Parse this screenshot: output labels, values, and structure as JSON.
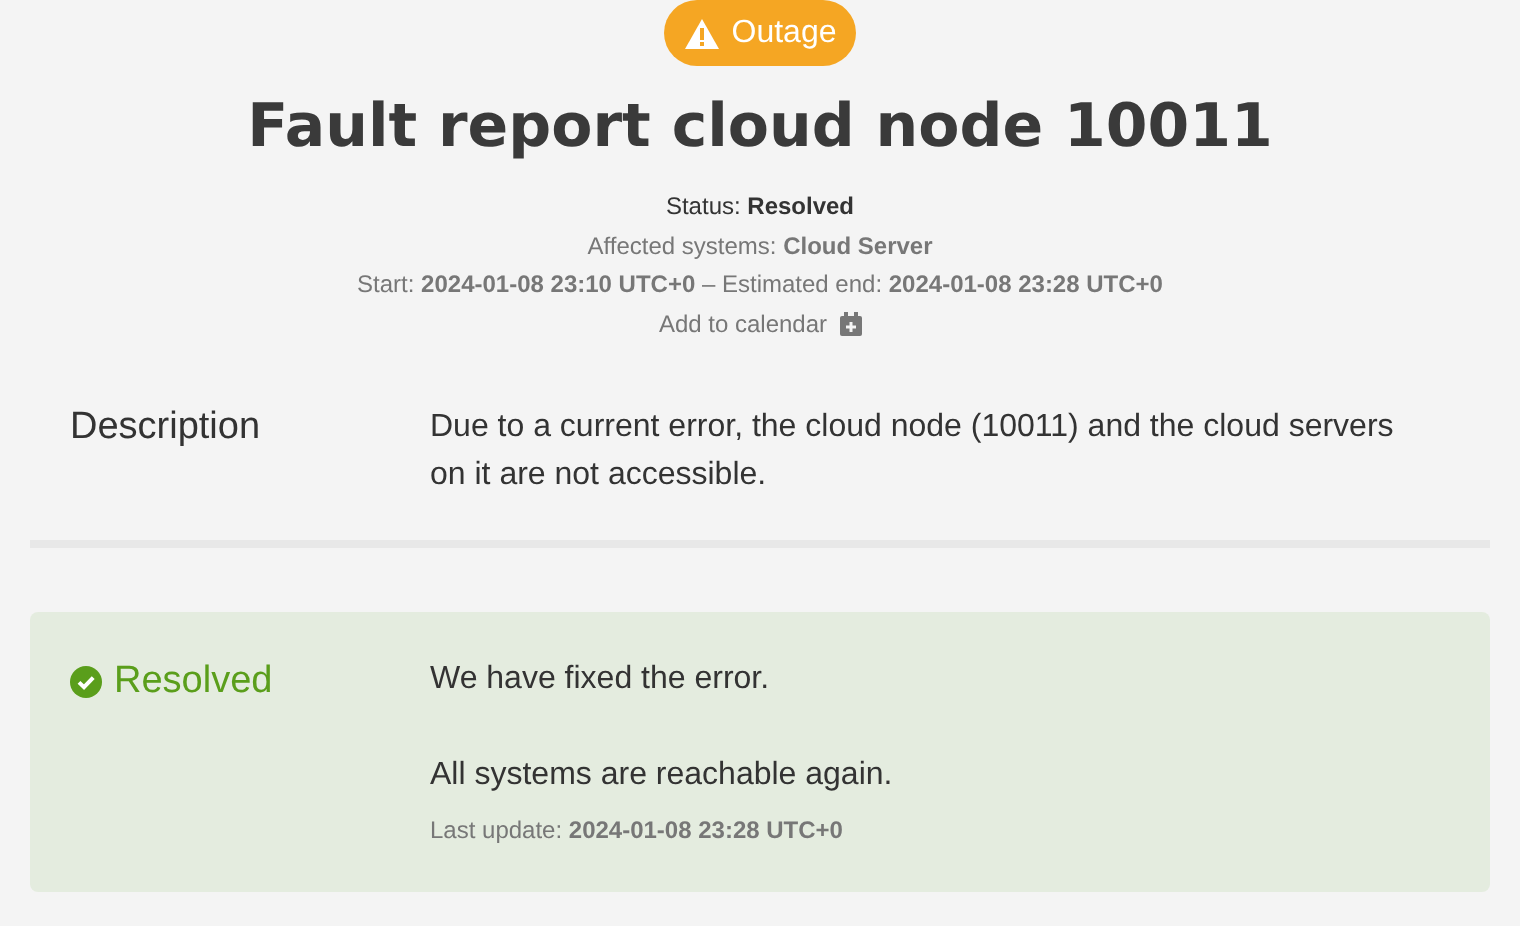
{
  "badge": {
    "kind": "outage",
    "label": "Outage"
  },
  "title": "Fault report cloud node 10011",
  "meta": [
    "Status: **Resolved**",
    "Affected systems: **Cloud Server**",
    "Start: **2024-01-08 23:10 UTC+0** – Estimated end: **2024-01-08 23:28 UTC+0**"
  ],
  "calendar_link": "Add to calendar",
  "description": {
    "label": "Description",
    "text": "Due to a current error, the cloud node (10011) and the cloud servers on it are not accessible."
  },
  "updates": [
    {
      "kind": "resolved",
      "label": "Resolved",
      "paragraphs": [
        "We have fixed the error.",
        "All systems are reachable again."
      ],
      "last_update": "Last update: **2024-01-08 23:28 UTC+0**"
    }
  ]
}
